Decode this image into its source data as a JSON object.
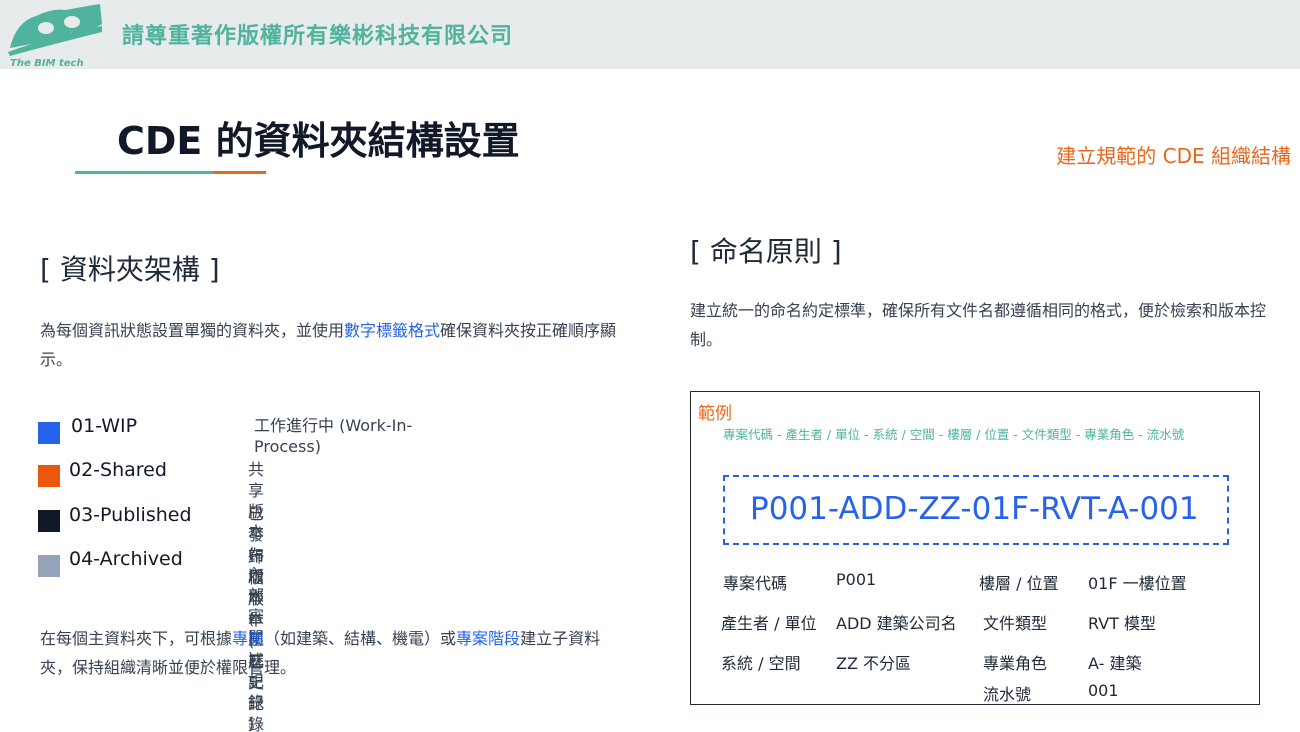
{
  "header": {
    "logo_text": "The BIM tech",
    "copyright": "請尊重著作版權所有樂彬科技有限公司",
    "colors": {
      "bar": "#e8ebeb",
      "brand": "#4fb39e",
      "accent": "#e8671c"
    }
  },
  "page": {
    "title": "CDE 的資料夾結構設置",
    "subtitle": "建立規範的 CDE 組織結構"
  },
  "left": {
    "heading": "[  資料夾架構 ]",
    "intro_pre": "為每個資訊狀態設置單獨的資料夾，並使用",
    "intro_hl": "數字標籤格式",
    "intro_post": "確保資料夾按正確順序顯示。",
    "folders": [
      {
        "name": "01-WIP",
        "desc": "工作進行中 (Work-In-Process)",
        "color": "#2563eb"
      },
      {
        "name": "02-Shared",
        "desc": "共享版本 ( 內部審閱 )",
        "color": "#ea580c"
      },
      {
        "name": "03-Published",
        "desc": "已發布版本 ( 正式記錄 )",
        "color": "#111827"
      },
      {
        "name": "04-Archived",
        "desc": "歸檔版本 ( 歷史記錄 )",
        "color": "#94a3b8"
      }
    ],
    "footer_pre": "在每個主資料夾下，可根據",
    "footer_hl1": "專業",
    "footer_mid": "（如建築、結構、機電）或",
    "footer_hl2": "專案階段",
    "footer_post": "建立子資料夾，保持組織清晰並便於權限管理。"
  },
  "right": {
    "heading": "[  命名原則 ]",
    "intro": "建立統一的命名約定標準，確保所有文件名都遵循相同的格式，便於檢索和版本控制。",
    "example": {
      "title": "範例",
      "format": "專案代碼 - 產生者 / 單位 - 系統 / 空間 -  樓層 / 位置 - 文件類型 -  專業角色 - 流水號",
      "code": "P001-ADD-ZZ-01F-RVT-A-001",
      "fields": [
        {
          "label": "專案代碼",
          "value": "P001"
        },
        {
          "label": "產生者 / 單位",
          "value": "ADD 建築公司名"
        },
        {
          "label": "系統 / 空間",
          "value": "ZZ 不分區"
        },
        {
          "label": "樓層 / 位置",
          "value": "01F 一樓位置"
        },
        {
          "label": "文件類型",
          "value": "RVT 模型"
        },
        {
          "label": "專業角色",
          "value": "A- 建築"
        },
        {
          "label": "流水號",
          "value": "001"
        }
      ]
    }
  }
}
